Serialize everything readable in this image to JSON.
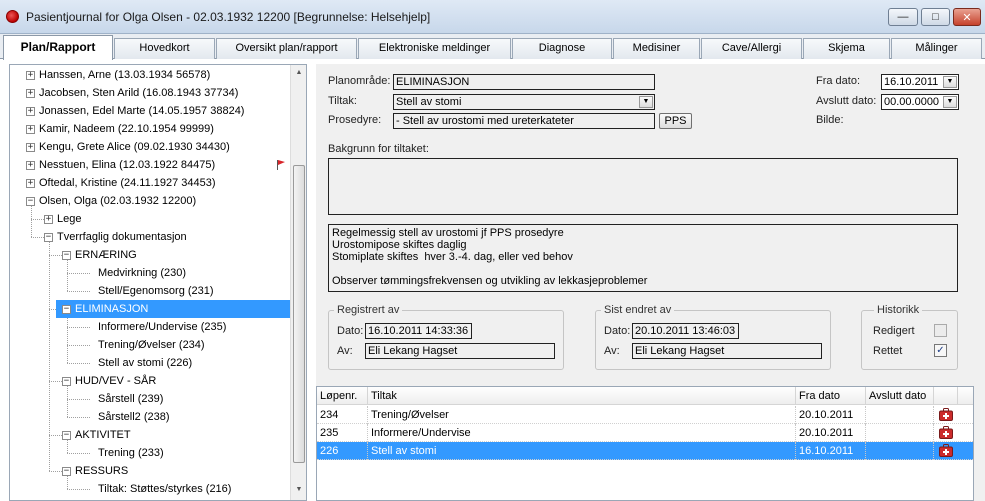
{
  "window": {
    "title": "Pasientjournal for Olga Olsen - 02.03.1932 12200   [Begrunnelse: Helsehjelp]",
    "minimize_glyph": "—",
    "maximize_glyph": "□",
    "close_glyph": "✕"
  },
  "tabs": [
    {
      "label": "Plan/Rapport",
      "active": true
    },
    {
      "label": "Hovedkort"
    },
    {
      "label": "Oversikt plan/rapport"
    },
    {
      "label": "Elektroniske meldinger"
    },
    {
      "label": "Diagnose"
    },
    {
      "label": "Medisiner"
    },
    {
      "label": "Cave/Allergi"
    },
    {
      "label": "Skjema"
    },
    {
      "label": "Målinger"
    }
  ],
  "tree": {
    "rows": [
      {
        "text": "Hanssen, Arne (13.03.1934 56578)",
        "expander": "+"
      },
      {
        "text": "Jacobsen, Sten Arild (16.08.1943 37734)",
        "expander": "+"
      },
      {
        "text": "Jonassen, Edel Marte (14.05.1957 38824)",
        "expander": "+"
      },
      {
        "text": "Kamir, Nadeem (22.10.1954 99999)",
        "expander": "+"
      },
      {
        "text": "Kengu, Grete Alice (09.02.1930 34430)",
        "expander": "+"
      },
      {
        "text": "Nesstuen, Elina (12.03.1922 84475)",
        "expander": "+",
        "flag": true
      },
      {
        "text": "Oftedal, Kristine (24.11.1927 34453)",
        "expander": "+"
      },
      {
        "text": "Olsen, Olga (02.03.1932 12200)",
        "expander": "−"
      },
      {
        "text": "Lege",
        "expander": "+"
      },
      {
        "text": "Tverrfaglig dokumentasjon",
        "expander": "−"
      },
      {
        "text": "ERNÆRING",
        "expander": "−"
      },
      {
        "text": "Medvirkning (230)"
      },
      {
        "text": "Stell/Egenomsorg (231)"
      },
      {
        "text": "ELIMINASJON",
        "expander": "−",
        "selected": true
      },
      {
        "text": "Informere/Undervise (235)"
      },
      {
        "text": "Trening/Øvelser (234)"
      },
      {
        "text": "Stell av stomi (226)"
      },
      {
        "text": "HUD/VEV  - SÅR",
        "expander": "−"
      },
      {
        "text": "Sårstell (239)"
      },
      {
        "text": "Sårstell2 (238)"
      },
      {
        "text": "AKTIVITET",
        "expander": "−"
      },
      {
        "text": "Trening (233)"
      },
      {
        "text": "RESSURS",
        "expander": "−"
      },
      {
        "text": "Tiltak: Støttes/styrkes (216)"
      }
    ]
  },
  "form": {
    "planomrade_label": "Planområde:",
    "planomrade_value": "ELIMINASJON",
    "tiltak_label": "Tiltak:",
    "tiltak_value": "Stell av stomi",
    "prosedyre_label": "Prosedyre:",
    "prosedyre_value": "- Stell av urostomi med ureterkateter",
    "pps_button": "PPS",
    "fra_dato_label": "Fra dato:",
    "fra_dato_value": "16.10.2011",
    "avslutt_dato_label": "Avslutt dato:",
    "avslutt_dato_value": "00.00.0000",
    "bilde_label": "Bilde:",
    "bakgrunn_label": "Bakgrunn for tiltaket:",
    "bakgrunn_text": "",
    "description_text": "Regelmessig stell av urostomi jf PPS prosedyre\nUrostomipose skiftes daglig\nStomiplate skiftes  hver 3.-4. dag, eller ved behov\n\nObserver tømmingsfrekvensen og utvikling av lekkasjeproblemer",
    "registrert": {
      "title": "Registrert av",
      "dato_label": "Dato:",
      "dato_value": "16.10.2011  14:33:36",
      "av_label": "Av:",
      "av_value": "Eli Lekang Hagset"
    },
    "sist_endret": {
      "title": "Sist endret av",
      "dato_label": "Dato:",
      "dato_value": "20.10.2011  13:46:03",
      "av_label": "Av:",
      "av_value": "Eli Lekang Hagset"
    },
    "historikk": {
      "title": "Historikk",
      "redigert_label": "Redigert",
      "redigert_checked": false,
      "rettet_label": "Rettet",
      "rettet_checked": true,
      "check_glyph": "✓"
    },
    "dropdown_glyph": "▼"
  },
  "grid": {
    "headers": [
      "Løpenr.",
      "Tiltak",
      "Fra dato",
      "Avslutt dato",
      ""
    ],
    "rows": [
      {
        "lopenr": "234",
        "tiltak": "Trening/Øvelser",
        "fra_dato": "20.10.2011",
        "avslutt_dato": ""
      },
      {
        "lopenr": "235",
        "tiltak": "Informere/Undervise",
        "fra_dato": "20.10.2011",
        "avslutt_dato": ""
      },
      {
        "lopenr": "226",
        "tiltak": "Stell av stomi",
        "fra_dato": "16.10.2011",
        "avslutt_dato": "",
        "selected": true
      }
    ]
  },
  "colors": {
    "selection": "#3399ff",
    "form_background": "#f0f0f0",
    "kit_icon": "#cc2b2b"
  }
}
